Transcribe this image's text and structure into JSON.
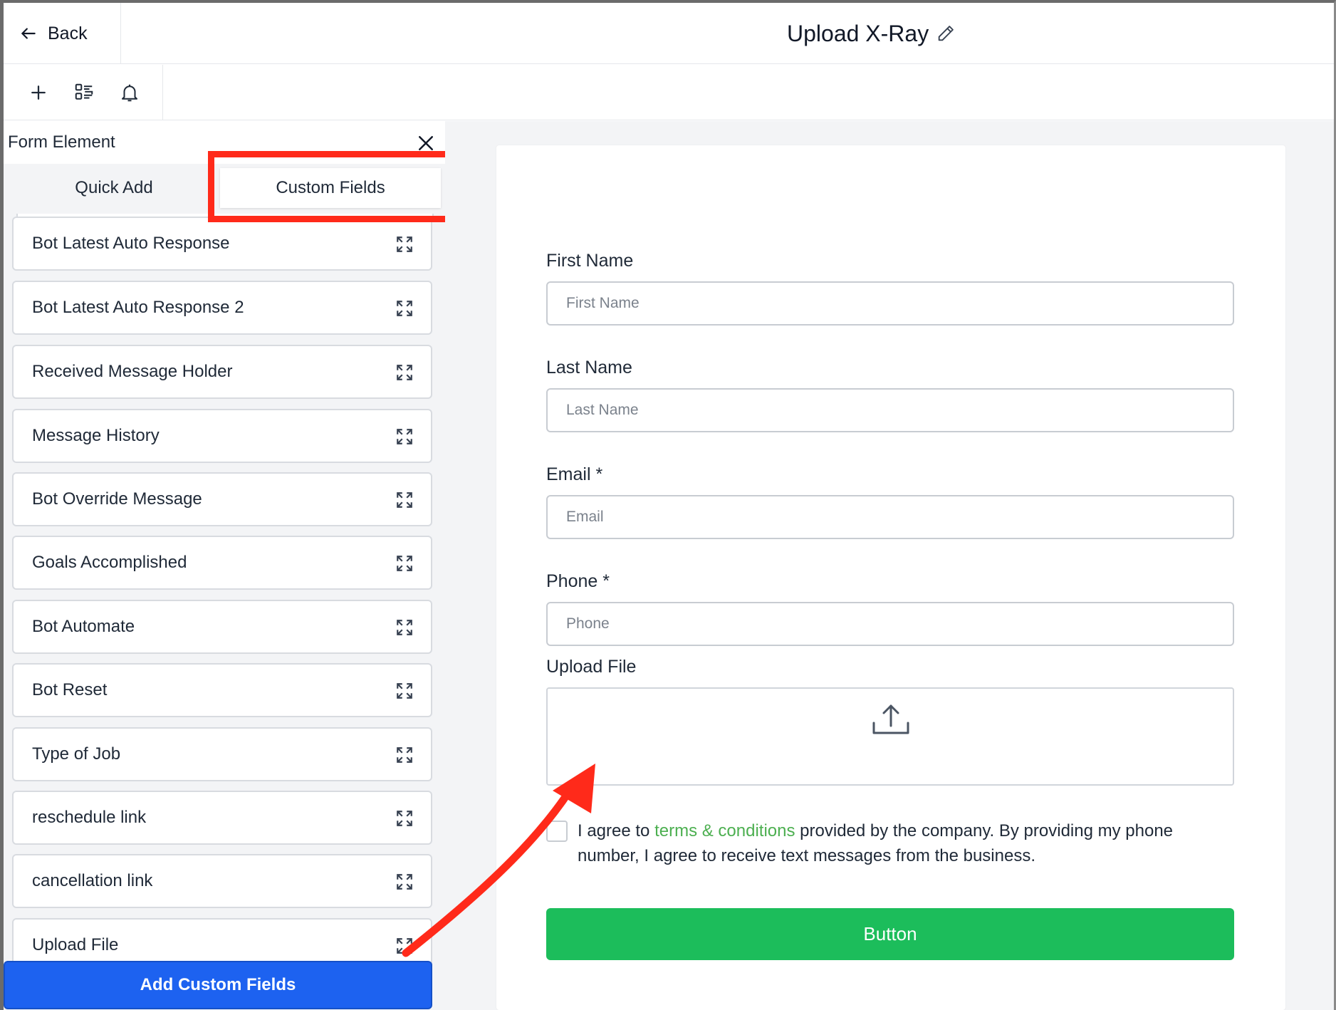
{
  "header": {
    "back_label": "Back",
    "title": "Upload X-Ray"
  },
  "toolbar": {
    "icons": [
      "plus-icon",
      "layout-icon",
      "bell-icon"
    ]
  },
  "panel": {
    "title": "Form Element",
    "tabs": [
      {
        "label": "Quick Add"
      },
      {
        "label": "Custom Fields",
        "active": true
      }
    ],
    "items": [
      {
        "label": "Bot Latest Auto Response"
      },
      {
        "label": "Bot Latest Auto Response 2"
      },
      {
        "label": "Received Message Holder"
      },
      {
        "label": "Message History"
      },
      {
        "label": "Bot Override Message"
      },
      {
        "label": "Goals Accomplished"
      },
      {
        "label": "Bot Automate"
      },
      {
        "label": "Bot Reset"
      },
      {
        "label": "Type of Job"
      },
      {
        "label": "reschedule link"
      },
      {
        "label": "cancellation link"
      },
      {
        "label": "Upload File"
      }
    ],
    "add_button_label": "Add Custom Fields"
  },
  "form": {
    "fields": [
      {
        "label": "First Name",
        "placeholder": "First Name"
      },
      {
        "label": "Last Name",
        "placeholder": "Last Name"
      },
      {
        "label": "Email *",
        "placeholder": "Email"
      },
      {
        "label": "Phone *",
        "placeholder": "Phone"
      }
    ],
    "upload_label": "Upload File",
    "consent": {
      "before": "I agree to ",
      "link": "terms & conditions",
      "after": " provided by the company. By providing my phone number, I agree to receive text messages from the business."
    },
    "submit_label": "Button"
  },
  "colors": {
    "accent_blue": "#1d62f0",
    "submit_green": "#1cbd5b",
    "link_green": "#4caf50",
    "annotation_red": "#ff2a1a"
  }
}
